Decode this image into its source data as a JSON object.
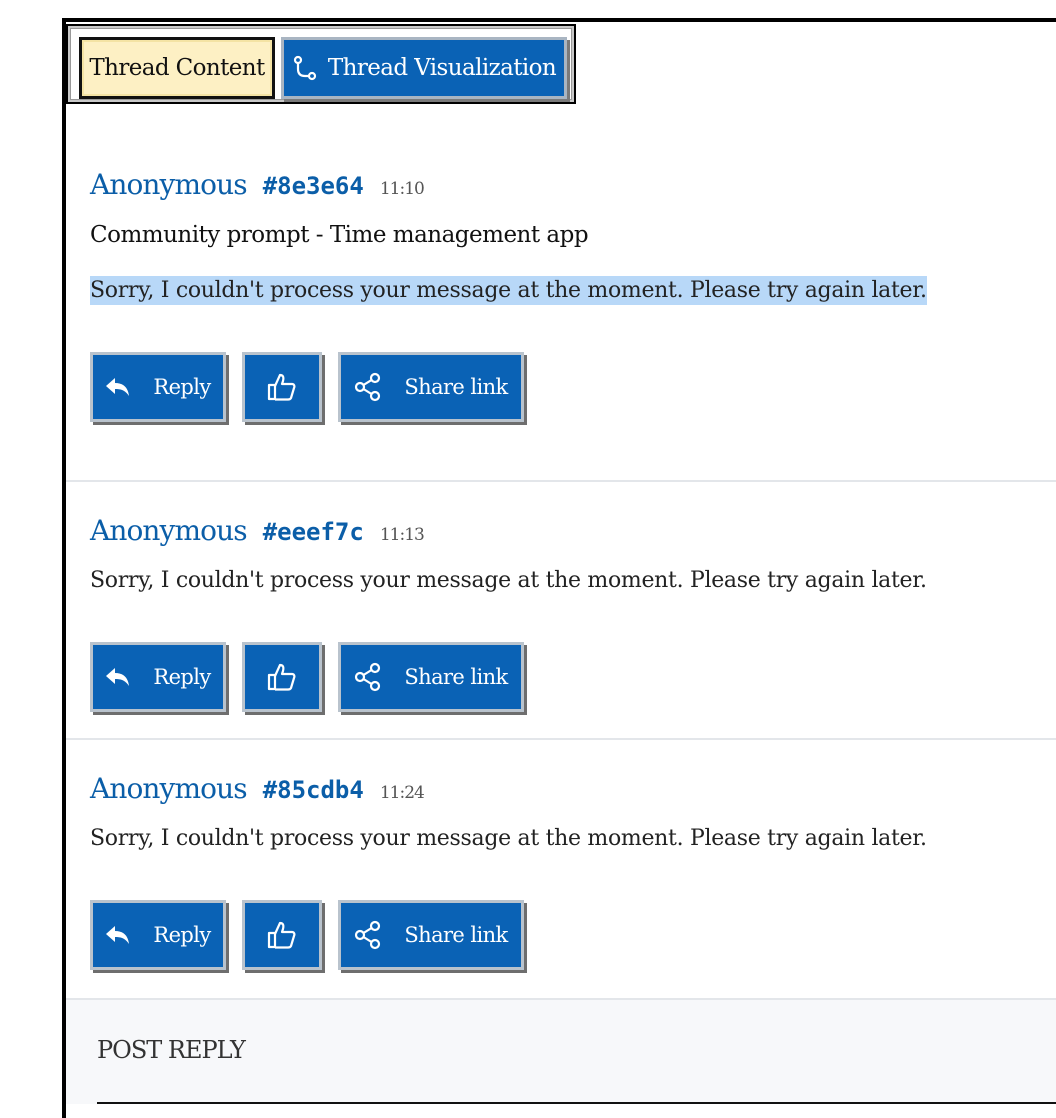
{
  "tabs": {
    "content_label": "Thread Content",
    "visualization_label": "Thread Visualization"
  },
  "posts": [
    {
      "author": "Anonymous",
      "hash": "#8e3e64",
      "time": "11:10",
      "subject": "Community prompt - Time management app",
      "body": "Sorry, I couldn't process your message at the moment. Please try again later."
    },
    {
      "author": "Anonymous",
      "hash": "#eeef7c",
      "time": "11:13",
      "body": "Sorry, I couldn't process your message at the moment. Please try again later."
    },
    {
      "author": "Anonymous",
      "hash": "#85cdb4",
      "time": "11:24",
      "body": "Sorry, I couldn't process your message at the moment. Please try again later."
    }
  ],
  "actions": {
    "reply_label": "Reply",
    "share_label": "Share link",
    "like_icon": "thumbs-up-icon",
    "reply_icon": "reply-arrow-icon",
    "share_icon": "share-icon"
  },
  "reply_form": {
    "title": "POST REPLY"
  },
  "colors": {
    "accent": "#0a62b5",
    "active_tab": "#fdf0c4",
    "selection": "#b8d8f8"
  }
}
